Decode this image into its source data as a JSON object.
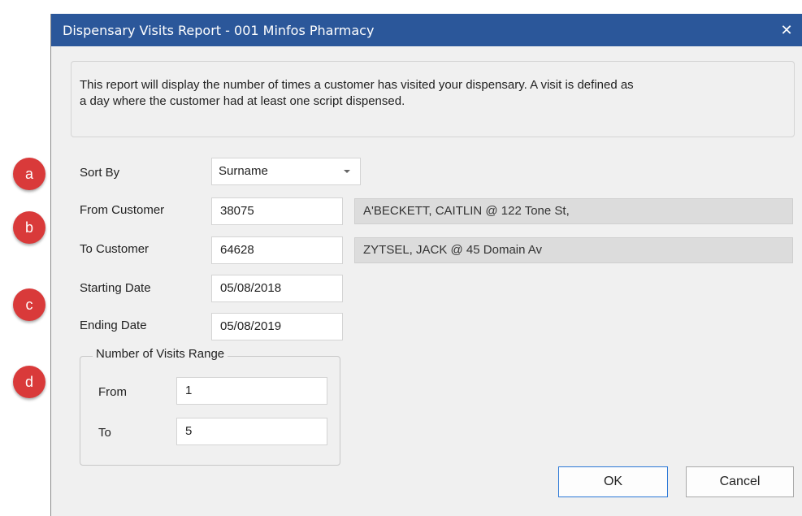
{
  "badges": [
    "a",
    "b",
    "c",
    "d"
  ],
  "dialog": {
    "title": "Dispensary Visits Report - 001 Minfos Pharmacy",
    "close_icon": "close-icon"
  },
  "description": {
    "line1": "This report will display the number of times a customer has visited your dispensary. A visit is defined as",
    "line2": "a day where the customer had at least one script dispensed."
  },
  "sort_by": {
    "label": "Sort By",
    "value": "Surname"
  },
  "from_customer": {
    "label": "From Customer",
    "code": "38075",
    "details": "A'BECKETT, CAITLIN @ 122 Tone St,"
  },
  "to_customer": {
    "label": "To Customer",
    "code": "64628",
    "details": "ZYTSEL, JACK @ 45 Domain Av"
  },
  "starting_date": {
    "label": "Starting Date",
    "value": "05/08/2018"
  },
  "ending_date": {
    "label": "Ending Date",
    "value": "05/08/2019"
  },
  "visits_range": {
    "legend": "Number of Visits Range",
    "from_label": "From",
    "from_value": "1",
    "to_label": "To",
    "to_value": "5"
  },
  "buttons": {
    "ok": "OK",
    "cancel": "Cancel"
  },
  "colors": {
    "titlebar": "#2b579a",
    "badge": "#d93a3a",
    "ok_border": "#2b78d7"
  }
}
